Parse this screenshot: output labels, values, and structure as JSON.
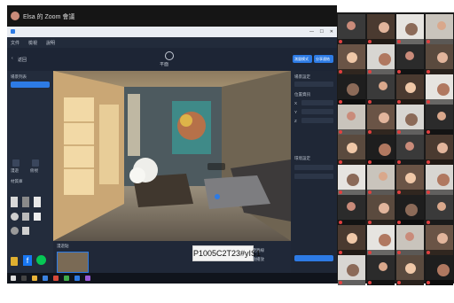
{
  "zoom": {
    "meeting_title": "Elsa 的 Zoom 會議"
  },
  "app": {
    "menu": [
      "文件",
      "檢視",
      "說明"
    ],
    "toolbar": {
      "back_label": "返回",
      "center_label": "平面",
      "right_buttons": [
        "測量模式",
        "分享連結"
      ]
    },
    "left_panel": {
      "title": "場景列表",
      "modes": [
        "漫遊",
        "俯視"
      ],
      "section": "材質庫"
    },
    "right_panel": {
      "title": "場景設定",
      "section2": "位置資訊",
      "section3": "環境設定",
      "fields": [
        "X",
        "Y",
        "Z"
      ]
    },
    "bottom_strip": {
      "title": "漫遊點",
      "items": [
        "導覽路線",
        "自動播放"
      ]
    }
  },
  "caption": "P1005C2T23#yIS1",
  "gallery": {
    "tiles": 36
  },
  "colors": {
    "accent": "#2d7be5",
    "app_bg": "#1b2230",
    "viewport_bg": "#6b5c48"
  }
}
